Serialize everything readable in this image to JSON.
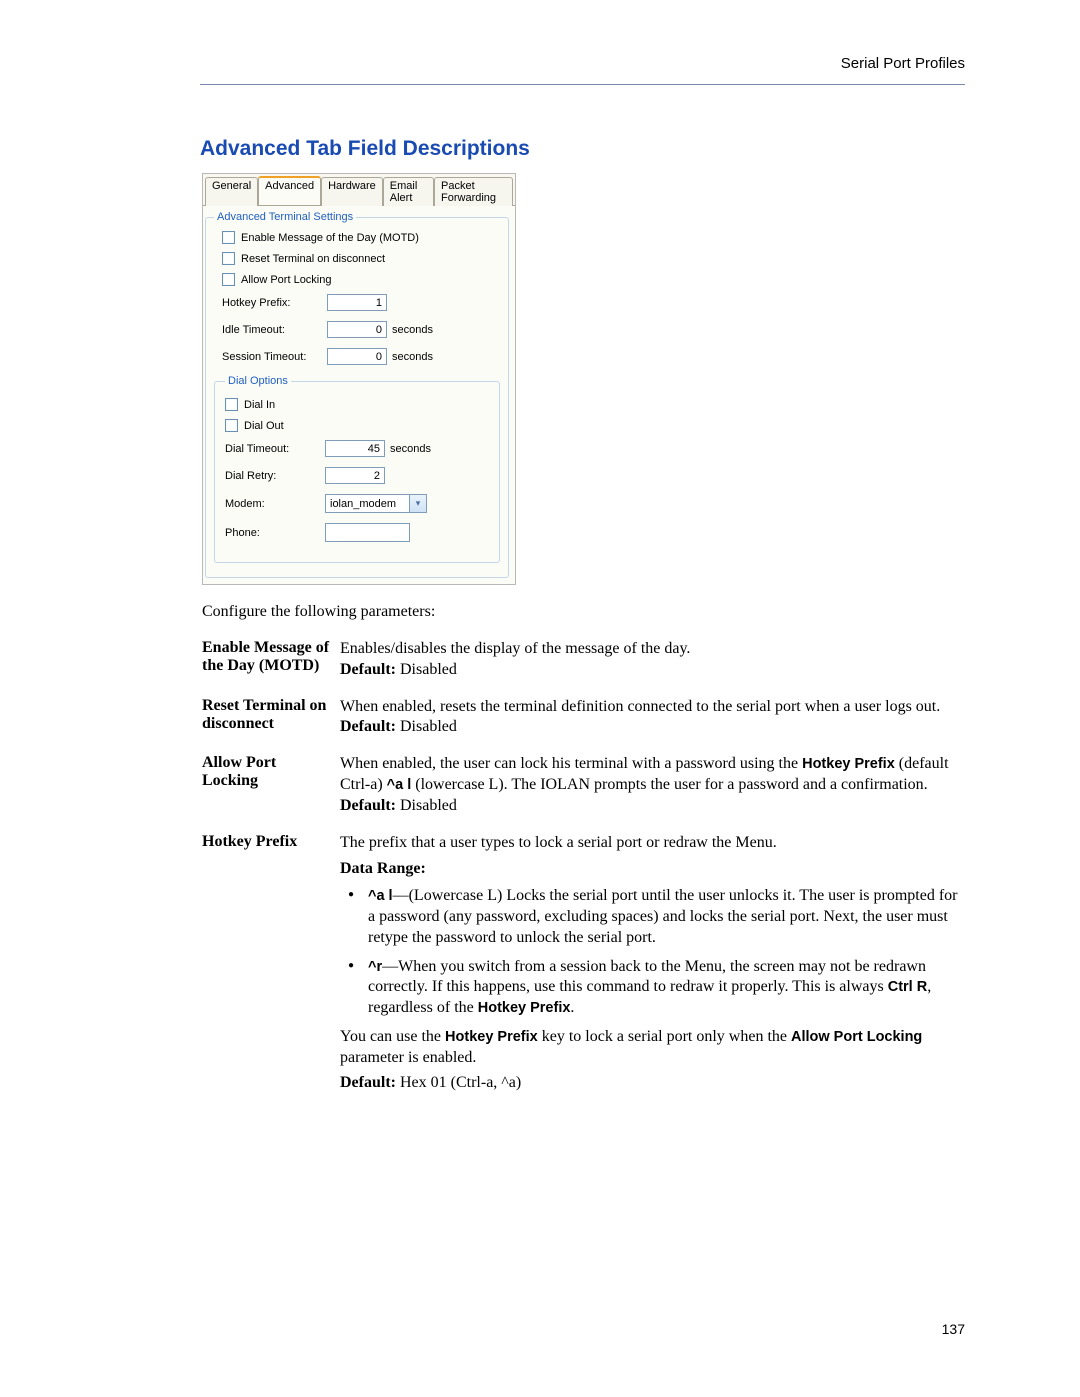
{
  "header": {
    "breadcrumb": "Serial Port Profiles"
  },
  "section_title": "Advanced Tab Field Descriptions",
  "screenshot": {
    "tabs": [
      "General",
      "Advanced",
      "Hardware",
      "Email Alert",
      "Packet Forwarding"
    ],
    "active_tab_index": 1,
    "fieldset1_legend": "Advanced Terminal Settings",
    "checkboxes": {
      "motd": "Enable Message of the Day (MOTD)",
      "reset": "Reset Terminal on disconnect",
      "allow_lock": "Allow Port Locking"
    },
    "hotkey": {
      "label": "Hotkey Prefix:",
      "value": "1"
    },
    "idle": {
      "label": "Idle Timeout:",
      "value": "0",
      "unit": "seconds"
    },
    "session": {
      "label": "Session Timeout:",
      "value": "0",
      "unit": "seconds"
    },
    "fieldset2_legend": "Dial Options",
    "dial_in": "Dial In",
    "dial_out": "Dial Out",
    "dial_timeout": {
      "label": "Dial Timeout:",
      "value": "45",
      "unit": "seconds"
    },
    "dial_retry": {
      "label": "Dial Retry:",
      "value": "2"
    },
    "modem": {
      "label": "Modem:",
      "value": "iolan_modem"
    },
    "phone": {
      "label": "Phone:",
      "value": ""
    }
  },
  "intro": "Configure the following parameters:",
  "params": {
    "p1": {
      "label": "Enable Message of the Day (MOTD)",
      "line1": "Enables/disables the display of the message of the day.",
      "default_label": "Default:",
      "default_val": " Disabled"
    },
    "p2": {
      "label": "Reset Terminal on disconnect",
      "line1": "When enabled, resets the terminal definition connected to the serial port when a user logs out.",
      "default_label": "Default:",
      "default_val": " Disabled"
    },
    "p3": {
      "label": "Allow Port Locking",
      "pre": "When enabled, the user can lock his terminal with a password using the ",
      "kb1": "Hotkey Prefix",
      "mid1": " (default Ctrl-a) ",
      "kb2": "^a l",
      "mid2": " (lowercase L). The IOLAN prompts the user for a password and a confirmation.",
      "default_label": "Default:",
      "default_val": " Disabled"
    },
    "p4": {
      "label": "Hotkey Prefix",
      "line1": "The prefix that a user types to lock a serial port or redraw the Menu.",
      "data_range": "Data Range:",
      "b1_kb": "^a l",
      "b1_txt": "—(Lowercase L) Locks the serial port until the user unlocks it. The user is prompted for a password (any password, excluding spaces) and locks the serial port. Next, the user must retype the password to unlock the serial port.",
      "b2_kb": "^r",
      "b2_txt_a": "—When you switch from a session back to the Menu, the screen may not be redrawn correctly. If this happens, use this command to redraw it properly. This is always ",
      "b2_kb2": "Ctrl R",
      "b2_txt_b": ", regardless of the ",
      "b2_kb3": "Hotkey Prefix",
      "b2_txt_c": ".",
      "note_a": "You can use the ",
      "note_kb1": "Hotkey Prefix",
      "note_b": " key to lock a serial port only when the ",
      "note_kb2": "Allow Port Locking",
      "note_c": " parameter is enabled.",
      "default_label": "Default:",
      "default_val": " Hex 01 (Ctrl-a, ^a)"
    }
  },
  "page_number": "137"
}
